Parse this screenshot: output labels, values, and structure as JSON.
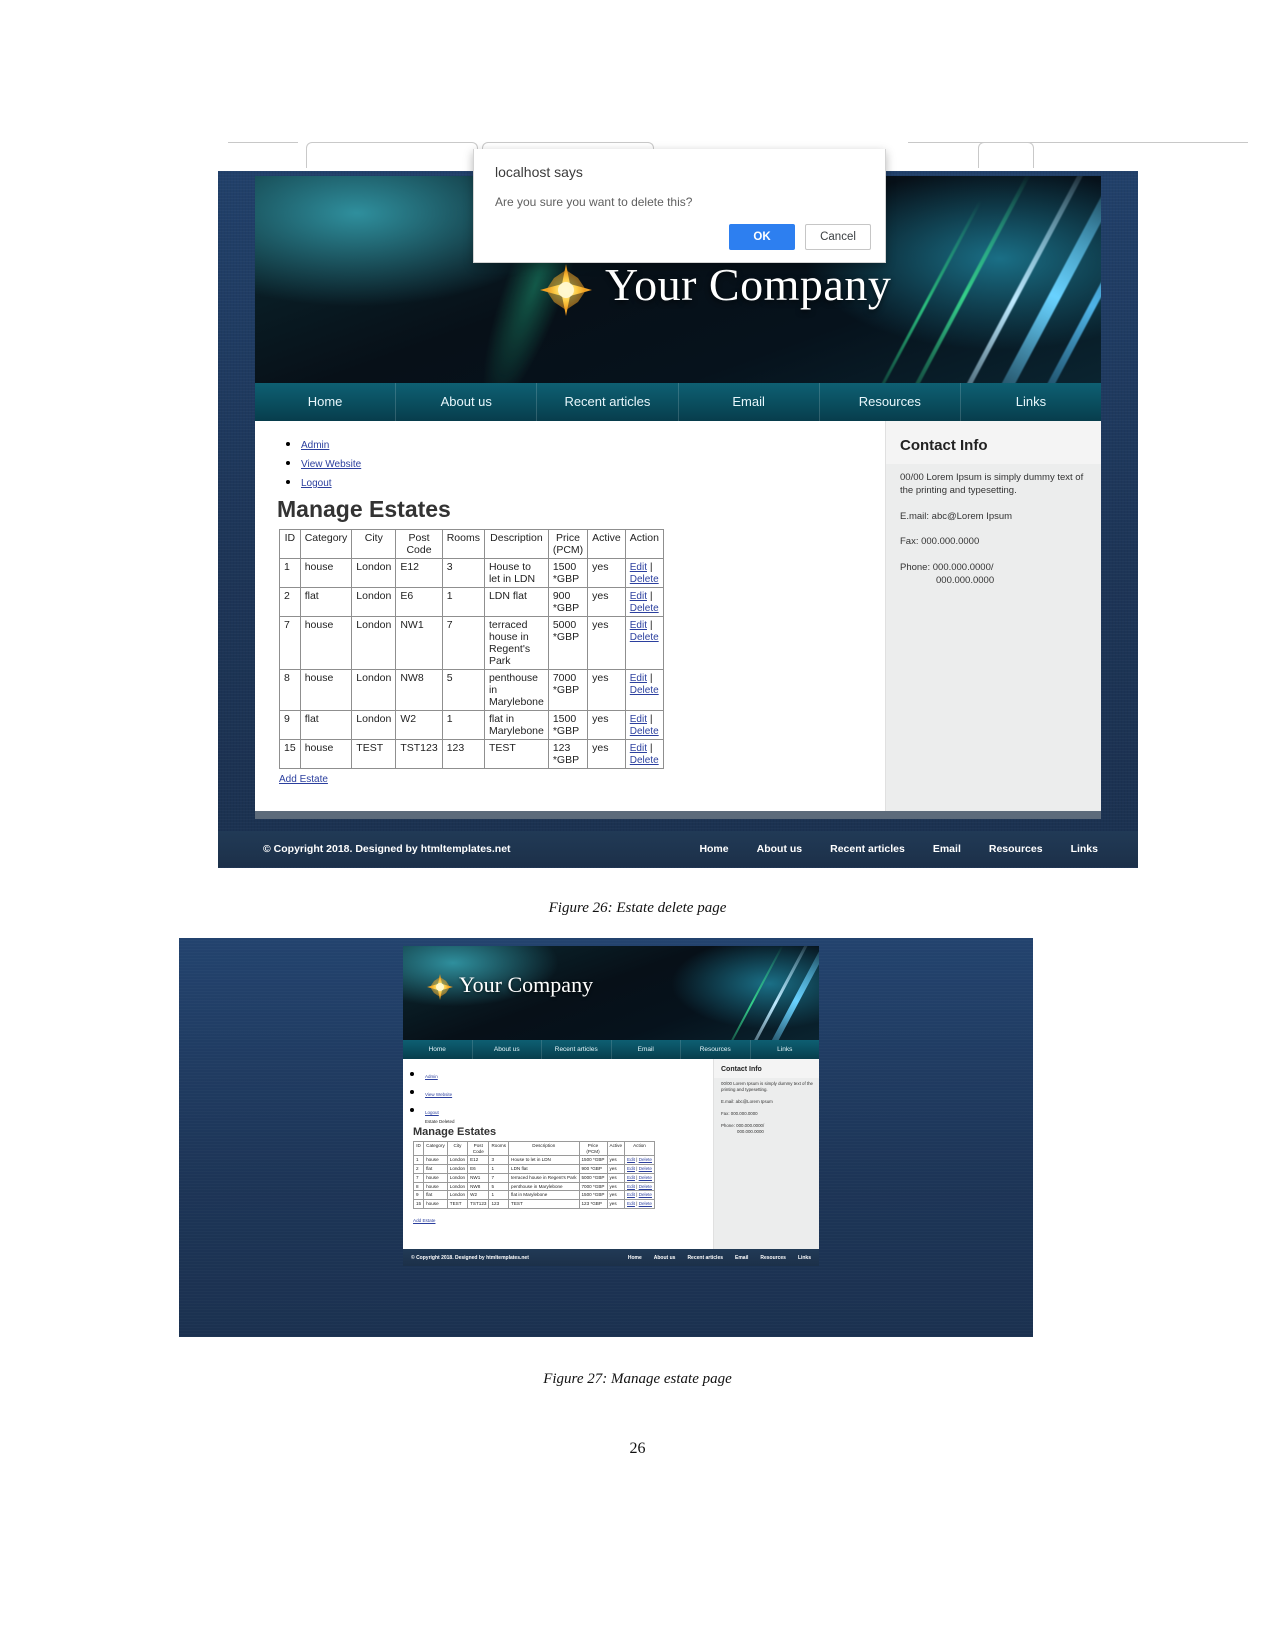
{
  "document": {
    "page_number": "26",
    "figure1_caption": "Figure 26: Estate delete page",
    "figure2_caption": "Figure 27: Manage estate page"
  },
  "dialog": {
    "title": "localhost says",
    "message": "Are you sure you want to delete this?",
    "ok_label": "OK",
    "cancel_label": "Cancel"
  },
  "site": {
    "brand": "Your Company",
    "nav": [
      "Home",
      "About us",
      "Recent articles",
      "Email",
      "Resources",
      "Links"
    ],
    "admin_links": [
      "Admin",
      "View Website",
      "Logout"
    ],
    "deleted_message": "Estate Deleted",
    "page_title": "Manage Estates",
    "add_estate_label": "Add Estate",
    "table": {
      "headers": [
        "ID",
        "Category",
        "City",
        "Post Code",
        "Rooms",
        "Description",
        "Price (PCM)",
        "Active",
        "Action"
      ],
      "header_post_code_line1": "Post",
      "header_post_code_line2": "Code",
      "header_price_line1": "Price",
      "header_price_line2": "(PCM)",
      "action_edit": "Edit",
      "action_sep": "|",
      "action_delete": "Delete",
      "rows": [
        {
          "id": "1",
          "category": "house",
          "city": "London",
          "post_code": "E12",
          "rooms": "3",
          "description": "House to let in LDN",
          "price": "1500 *GBP",
          "active": "yes"
        },
        {
          "id": "2",
          "category": "flat",
          "city": "London",
          "post_code": "E6",
          "rooms": "1",
          "description": "LDN flat",
          "price": "900 *GBP",
          "active": "yes"
        },
        {
          "id": "7",
          "category": "house",
          "city": "London",
          "post_code": "NW1",
          "rooms": "7",
          "description": "terraced house in Regent's Park",
          "price": "5000 *GBP",
          "active": "yes"
        },
        {
          "id": "8",
          "category": "house",
          "city": "London",
          "post_code": "NW8",
          "rooms": "5",
          "description": "penthouse in Marylebone",
          "price": "7000 *GBP",
          "active": "yes"
        },
        {
          "id": "9",
          "category": "flat",
          "city": "London",
          "post_code": "W2",
          "rooms": "1",
          "description": "flat in Marylebone",
          "price": "1500 *GBP",
          "active": "yes"
        },
        {
          "id": "15",
          "category": "house",
          "city": "TEST",
          "post_code": "TST123",
          "rooms": "123",
          "description": "TEST",
          "price": "123 *GBP",
          "active": "yes"
        }
      ]
    },
    "contact": {
      "title": "Contact Info",
      "lorem": "00/00 Lorem Ipsum is simply dummy text of the printing and typesetting.",
      "email": "E.mail: abc@Lorem Ipsum",
      "fax": "Fax: 000.000.0000",
      "phone": "Phone: 000.000.0000/",
      "phone2": "000.000.0000"
    },
    "footer": {
      "copyright": "© Copyright 2018. Designed by htmltemplates.net",
      "links": [
        "Home",
        "About us",
        "Recent articles",
        "Email",
        "Resources",
        "Links"
      ]
    }
  },
  "colors": {
    "page_bg": "#1e3a5c",
    "nav_bg": "#0a4f60",
    "link": "#2b3f9e",
    "primary_button": "#2d7ff0",
    "sidebar_bg": "#eceded"
  }
}
